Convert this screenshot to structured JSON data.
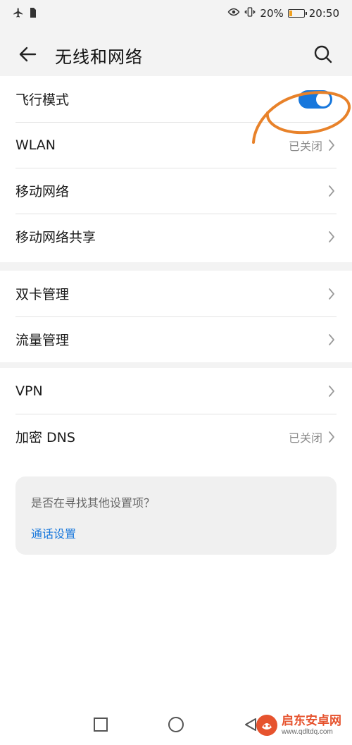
{
  "status_bar": {
    "battery_percent": "20%",
    "battery_level": 0.2,
    "time": "20:50",
    "left_icons": [
      "airplane-icon",
      "sim-icon"
    ],
    "right_icons": [
      "eye-comfort-icon",
      "vibrate-icon",
      "battery-icon"
    ]
  },
  "header": {
    "title": "无线和网络"
  },
  "group1": {
    "airplane_mode": {
      "label": "飞行模式",
      "enabled": true
    },
    "wlan": {
      "label": "WLAN",
      "status": "已关闭"
    },
    "mobile_network": {
      "label": "移动网络"
    },
    "tethering": {
      "label": "移动网络共享"
    }
  },
  "group2": {
    "dual_sim": {
      "label": "双卡管理"
    },
    "data_usage": {
      "label": "流量管理"
    }
  },
  "group3": {
    "vpn": {
      "label": "VPN"
    },
    "private_dns": {
      "label": "加密 DNS",
      "status": "已关闭"
    }
  },
  "suggestion": {
    "question": "是否在寻找其他设置项？",
    "link": "通话设置"
  },
  "watermark": {
    "title": "启东安卓网",
    "url": "www.qdltdq.com"
  },
  "colors": {
    "accent": "#1777dc",
    "annotation": "#e8822a",
    "watermark": "#e6532e"
  }
}
